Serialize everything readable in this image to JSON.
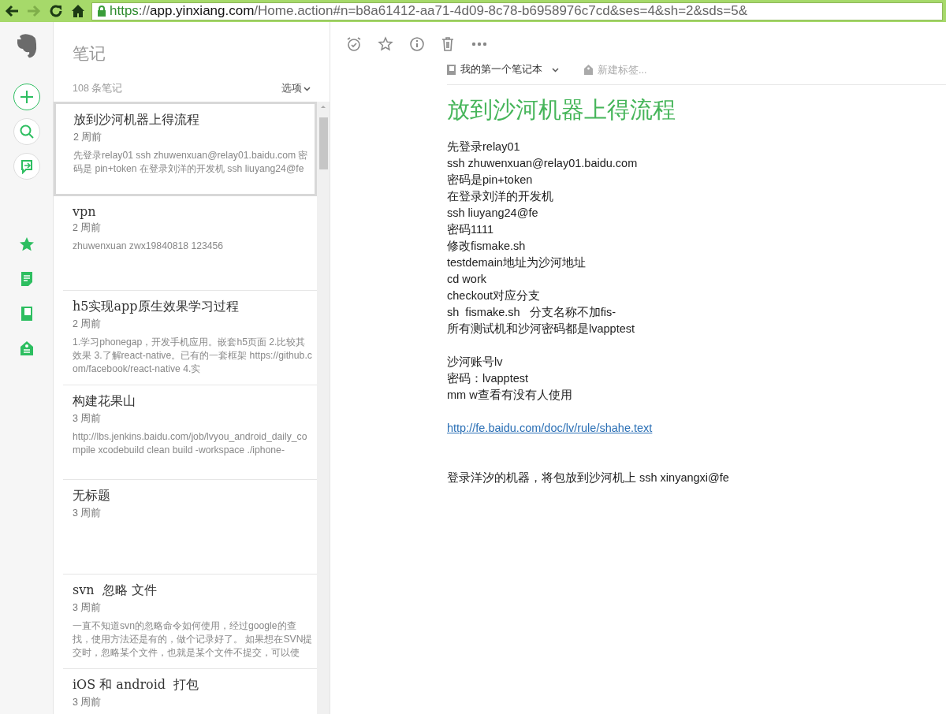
{
  "browser": {
    "back_disabled": false,
    "forward_disabled": true,
    "url": {
      "scheme": "https",
      "separator": "://",
      "host": "app.yinxiang.com",
      "path": "/Home.action#n=b8a61412-aa71-4d09-8c78-b6958976c7cd&ses=4&sh=2&sds=5&"
    }
  },
  "notes_panel": {
    "title": "笔记",
    "count": "108 条笔记",
    "options": "选项",
    "notes": [
      {
        "title": "放到沙河机器上得流程",
        "time": "2 周前",
        "preview": "先登录relay01 ssh zhuwenxuan@relay01.baidu.com 密码是 pin+token 在登录刘洋的开发机 ssh liuyang24@fe",
        "selected": true
      },
      {
        "title": "vpn",
        "time": "2 周前",
        "preview": "zhuwenxuan zwx19840818 123456",
        "selected": false
      },
      {
        "title": "h5实现app原生效果学习过程",
        "time": "2 周前",
        "preview": "1.学习phonegap，开发手机应用。嵌套h5页面 2.比较其效果 3.了解react-native。已有的一套框架 https://github.com/facebook/react-native 4.实",
        "selected": false
      },
      {
        "title": "构建花果山",
        "time": "3 周前",
        "preview": "http://lbs.jenkins.baidu.com/job/lvyou_android_daily_compile xcodebuild clean build -workspace ./iphone-",
        "selected": false
      },
      {
        "title": "无标题",
        "time": "3 周前",
        "selected": false
      },
      {
        "title": "svn  忽略 文件",
        "time": "3 周前",
        "preview": "一直不知道svn的忽略命令如何使用，经过google的查找，使用方法还是有的，做个记录好了。 如果想在SVN提交时，忽略某个文件，也就是某个文件不提交，可以使",
        "selected": false
      },
      {
        "title": "iOS 和 android  打包",
        "time": "3 周前",
        "selected": false
      }
    ]
  },
  "editor": {
    "notebook": "我的第一个笔记本",
    "tag_placeholder": "新建标签...",
    "title": "放到沙河机器上得流程",
    "lines": [
      {
        "kind": "text",
        "text": "先登录relay01"
      },
      {
        "kind": "text",
        "text": "ssh zhuwenxuan@relay01.baidu.com"
      },
      {
        "kind": "text",
        "text": "密码是pin+token"
      },
      {
        "kind": "text",
        "text": "在登录刘洋的开发机"
      },
      {
        "kind": "text",
        "text": "ssh liuyang24@fe"
      },
      {
        "kind": "text",
        "text": "密码1111"
      },
      {
        "kind": "text",
        "text": "修改fismake.sh"
      },
      {
        "kind": "text",
        "text": "testdemain地址为沙河地址"
      },
      {
        "kind": "text",
        "text": "cd work"
      },
      {
        "kind": "text",
        "text": "checkout对应分支"
      },
      {
        "kind": "text",
        "text": "sh  fismake.sh   分支名称不加fis-"
      },
      {
        "kind": "text",
        "text": "所有测试机和沙河密码都是lvapptest"
      },
      {
        "kind": "blank"
      },
      {
        "kind": "text",
        "text": "沙河账号lv"
      },
      {
        "kind": "text",
        "text": "密码：lvapptest"
      },
      {
        "kind": "text",
        "text": "mm w查看有没有人使用"
      },
      {
        "kind": "blank"
      },
      {
        "kind": "link",
        "text": "http://fe.baidu.com/doc/lv/rule/shahe.text"
      },
      {
        "kind": "blank"
      },
      {
        "kind": "blank"
      },
      {
        "kind": "text",
        "text": "登录洋汐的机器，将包放到沙河机上 ssh xinyangxi@fe"
      }
    ]
  }
}
